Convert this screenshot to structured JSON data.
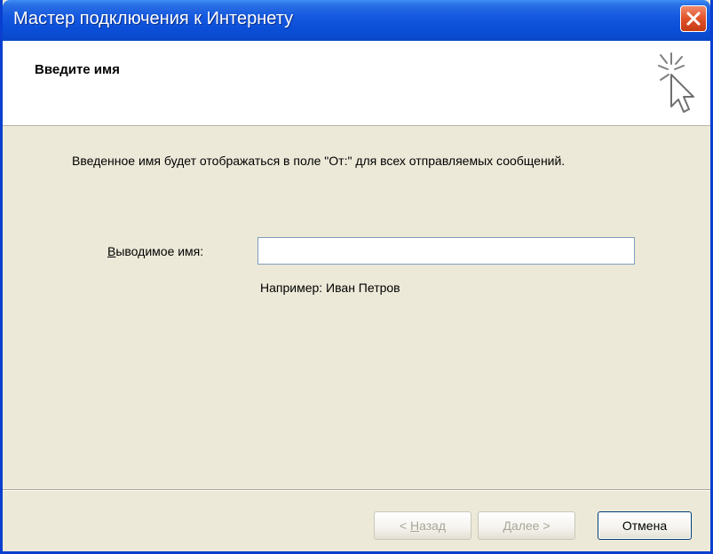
{
  "window": {
    "title": "Мастер подключения к Интернету"
  },
  "header": {
    "title": "Введите имя",
    "icon": "wizard-cursor-icon"
  },
  "content": {
    "description": "Введенное имя будет отображаться в поле \"От:\" для всех отправляемых сообщений.",
    "display_name_label_accel": "В",
    "display_name_label_rest": "ыводимое имя:",
    "display_name_value": "",
    "example": "Например: Иван Петров"
  },
  "buttons": {
    "back_prefix": "< ",
    "back_accel": "Н",
    "back_rest": "азад",
    "next_accel": "Д",
    "next_rest": "алее >",
    "cancel": "Отмена"
  },
  "colors": {
    "titlebar": "#0b4fd8",
    "close": "#e0522a",
    "dialog_bg": "#ece9d8",
    "input_border": "#7f9db9"
  }
}
